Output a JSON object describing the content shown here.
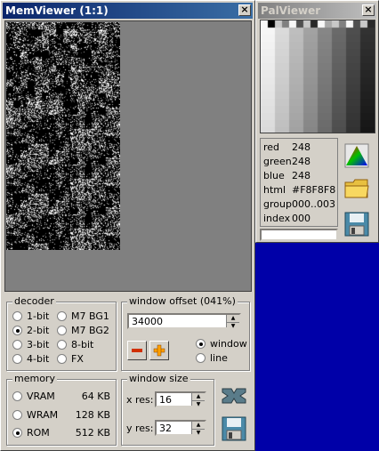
{
  "memviewer": {
    "title": "MemViewer (1:1)",
    "close": "×",
    "decoder": {
      "label": "decoder",
      "options": [
        "1-bit",
        "2-bit",
        "3-bit",
        "4-bit",
        "M7 BG1",
        "M7 BG2",
        "8-bit",
        "FX"
      ],
      "selected": "2-bit"
    },
    "window_offset": {
      "label": "window offset (041%)",
      "value": "34000",
      "mode_window": "window",
      "mode_line": "line",
      "selected_mode": "window",
      "minus_icon": "minus-icon",
      "plus_icon": "plus-icon"
    },
    "memory": {
      "label": "memory",
      "items": [
        {
          "name": "VRAM",
          "size": "64 KB"
        },
        {
          "name": "WRAM",
          "size": "128 KB"
        },
        {
          "name": "ROM",
          "size": "512 KB"
        }
      ],
      "selected": "ROM"
    },
    "window_size": {
      "label": "window size",
      "x_label": "x res:",
      "x_value": "16",
      "y_label": "y res:",
      "y_value": "32"
    }
  },
  "palviewer": {
    "title": "PalViewer",
    "close": "×",
    "info": {
      "red_label": "red",
      "red": "248",
      "green_label": "green",
      "green": "248",
      "blue_label": "blue",
      "blue": "248",
      "html_label": "html",
      "html": "#F8F8F8",
      "group_label": "group",
      "group": "000..003",
      "index_label": "index",
      "index": "000"
    },
    "status_text": ""
  },
  "colors": {
    "desktop": "#0000a8",
    "face": "#d4d0c8",
    "title_active": "#0a246a",
    "viewer_bg": "#808080",
    "minus": "#d03000",
    "plus": "#ffa000"
  }
}
